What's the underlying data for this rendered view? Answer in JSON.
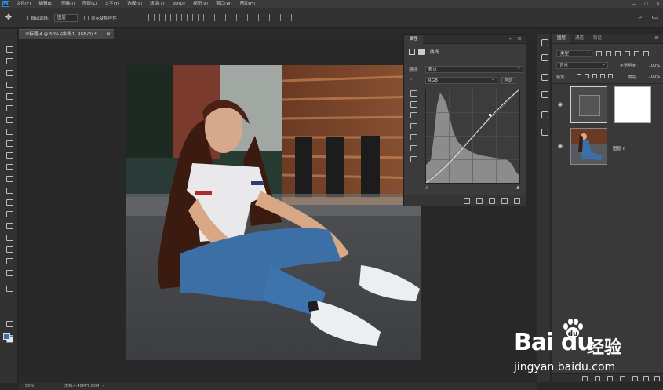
{
  "app": {
    "logo": "Ps"
  },
  "menu": [
    "文件(F)",
    "编辑(E)",
    "图像(I)",
    "图层(L)",
    "文字(Y)",
    "选择(S)",
    "滤镜(T)",
    "3D(D)",
    "视图(V)",
    "窗口(W)",
    "帮助(H)"
  ],
  "options_bar": {
    "auto_select_label": "自动选择:",
    "auto_select_value": "图层",
    "transform_controls_label": "显示变换控件"
  },
  "document": {
    "tab_title": "未标题-4 @ 50% (曲线 1, RGB/8) *",
    "zoom": "50%",
    "doc_info": "文档:4.40M/7.03M"
  },
  "properties_panel": {
    "tab": "属性",
    "adjustment_title": "曲线",
    "preset_label": "预设:",
    "preset_value": "默认",
    "channel_value": "RGB",
    "auto_button": "自动"
  },
  "layers_panel": {
    "tabs": [
      "图层",
      "通道",
      "路径"
    ],
    "kind_filter": "类型",
    "blend_mode": "正常",
    "opacity_label": "不透明度:",
    "opacity_value": "100%",
    "lock_label": "锁定:",
    "fill_label": "填充:",
    "fill_value": "100%",
    "layers": [
      {
        "name": "曲线 1",
        "type": "adjustment"
      },
      {
        "name": "图层 0",
        "type": "image"
      }
    ]
  },
  "watermark": {
    "brand": "Bai  du",
    "name": "经验",
    "url": "jingyan.baidu.com"
  },
  "colors": {
    "accent": "#2e8bd8",
    "foreground": "#3a6fb7",
    "background": "#e8e8e8"
  }
}
